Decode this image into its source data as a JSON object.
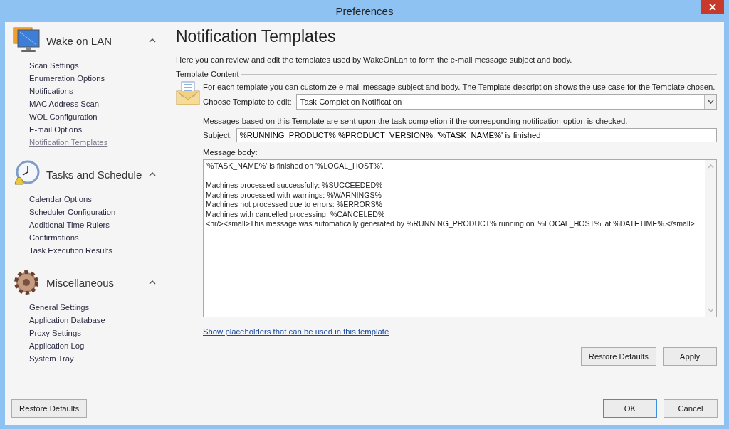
{
  "window": {
    "title": "Preferences"
  },
  "sidebar": {
    "sections": [
      {
        "title": "Wake on LAN",
        "expanded": true,
        "items": [
          {
            "label": "Scan Settings",
            "selected": false
          },
          {
            "label": "Enumeration Options",
            "selected": false
          },
          {
            "label": "Notifications",
            "selected": false
          },
          {
            "label": "MAC Address Scan",
            "selected": false
          },
          {
            "label": "WOL Configuration",
            "selected": false
          },
          {
            "label": "E-mail Options",
            "selected": false
          },
          {
            "label": "Notification Templates",
            "selected": true
          }
        ]
      },
      {
        "title": "Tasks and Schedule",
        "expanded": true,
        "items": [
          {
            "label": "Calendar Options",
            "selected": false
          },
          {
            "label": "Scheduler Configuration",
            "selected": false
          },
          {
            "label": "Additional Time Rulers",
            "selected": false
          },
          {
            "label": "Confirmations",
            "selected": false
          },
          {
            "label": "Task Execution Results",
            "selected": false
          }
        ]
      },
      {
        "title": "Miscellaneous",
        "expanded": true,
        "items": [
          {
            "label": "General Settings",
            "selected": false
          },
          {
            "label": "Application Database",
            "selected": false
          },
          {
            "label": "Proxy Settings",
            "selected": false
          },
          {
            "label": "Application Log",
            "selected": false
          },
          {
            "label": "System Tray",
            "selected": false
          }
        ]
      }
    ]
  },
  "page": {
    "title": "Notification Templates",
    "intro": "Here you can review and edit the templates used by WakeOnLan to form the e-mail message subject and body.",
    "group_title": "Template Content",
    "group_hint": "For each template you can customize e-mail message subject and body. The Template description shows the use case for the Template chosen.",
    "template_label": "Choose Template to edit:",
    "template_value": "Task Completion Notification",
    "template_description": "Messages based on this Template are sent upon the task completion if the corresponding notification option is checked.",
    "subject_label": "Subject:",
    "subject_value": "%RUNNING_PRODUCT% %PRODUCT_VERSION%: '%TASK_NAME%' is finished",
    "body_label": "Message body:",
    "body_value": "'%TASK_NAME%' is finished on '%LOCAL_HOST%'.\n\nMachines processed successfully: %SUCCEEDED%\nMachines processed with warnings: %WARNINGS%\nMachines not processed due to errors: %ERRORS%\nMachines with cancelled processing: %CANCELED%\n<hr/><small>This message was automatically generated by %RUNNING_PRODUCT% running on '%LOCAL_HOST%' at %DATETIME%.</small>",
    "placeholders_link": "Show placeholders that can be used in this template",
    "buttons": [
      "Restore Defaults",
      "Apply"
    ]
  },
  "footer": {
    "left_button": "Restore Defaults",
    "buttons": [
      {
        "label": "OK",
        "default": true
      },
      {
        "label": "Cancel",
        "default": false
      }
    ]
  }
}
